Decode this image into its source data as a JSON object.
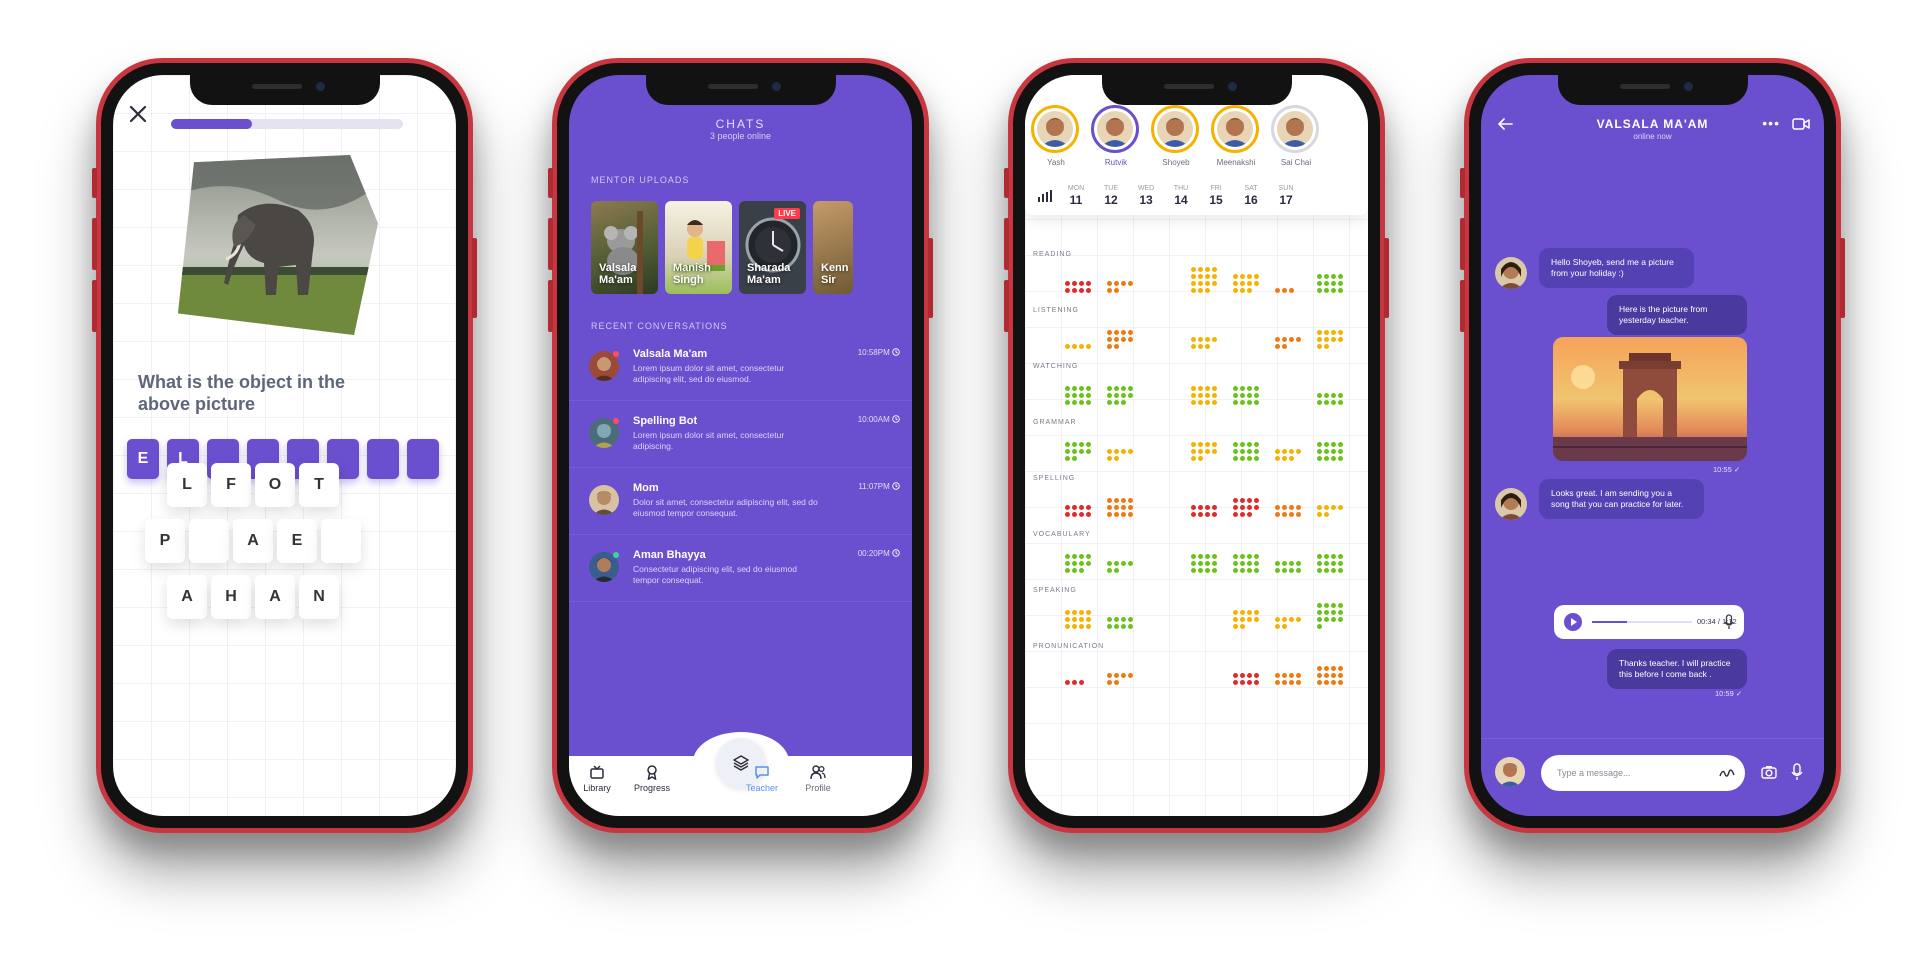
{
  "quiz": {
    "progress": 0.35,
    "question": "What is the object in the above picture",
    "answer_slots": [
      "E",
      "L",
      "",
      "",
      "",
      "",
      "",
      ""
    ],
    "tiles_row1": [
      "L",
      "F",
      "O",
      "T"
    ],
    "tiles_row2": [
      "P",
      "",
      "A",
      "E",
      ""
    ],
    "tiles_row3": [
      "A",
      "H",
      "A",
      "N"
    ]
  },
  "chats": {
    "title": "CHATS",
    "subtitle": "3 people online",
    "mentor_uploads_label": "MENTOR UPLOADS",
    "uploads": [
      {
        "name_line1": "Valsala",
        "name_line2": "Ma'am"
      },
      {
        "name_line1": "Manish",
        "name_line2": "Singh"
      },
      {
        "name_line1": "Sharada",
        "name_line2": "Ma'am",
        "live": "LIVE"
      },
      {
        "name_line1": "Kenn",
        "name_line2": "Sir"
      }
    ],
    "recent_label": "RECENT CONVERSATIONS",
    "conversations": [
      {
        "name": "Valsala Ma'am",
        "time": "10:58PM",
        "message": "Lorem ipsum dolor sit amet, consectetur adipiscing elit, sed do eiusmod."
      },
      {
        "name": "Spelling Bot",
        "time": "10:00AM",
        "message": "Lorem ipsum dolor sit amet, consectetur adipiscing."
      },
      {
        "name": "Mom",
        "time": "11:07PM",
        "message": "Dolor sit amet, consectetur adipiscing elit, sed do eiusmod tempor consequat."
      },
      {
        "name": "Aman Bhayya",
        "time": "00:20PM",
        "message": "Consectetur adipiscing elit, sed do eiusmod tempor consequat."
      }
    ],
    "tabs": [
      "Library",
      "Progress",
      "Teacher",
      "Profile"
    ],
    "accent": "#6a4fcf",
    "active_tab_color": "#5b8def"
  },
  "progress_screen": {
    "students": [
      "Yash",
      "Rutvik",
      "Shoyeb",
      "Meenakshi",
      "Sai Chai"
    ],
    "days": [
      {
        "d": "MON",
        "n": "11"
      },
      {
        "d": "TUE",
        "n": "12"
      },
      {
        "d": "WED",
        "n": "13"
      },
      {
        "d": "THU",
        "n": "14"
      },
      {
        "d": "FRI",
        "n": "15"
      },
      {
        "d": "SAT",
        "n": "16"
      },
      {
        "d": "SUN",
        "n": "17"
      }
    ],
    "skills": [
      "READING",
      "LISTENING",
      "WATCHING",
      "GRAMMAR",
      "SPELLING",
      "VOCABULARY",
      "SPEAKING",
      "PRONUNICATION"
    ],
    "colors": {
      "red": "#e02b2b",
      "orange": "#f07a12",
      "yellow": "#f5b300",
      "green": "#6cc21a",
      "ring_yellow": "#f5b300",
      "ring_purple": "#6a4fcf"
    }
  },
  "chat_detail": {
    "name": "VALSALA MA'AM",
    "status": "online now",
    "messages": [
      {
        "from": "in",
        "text": "Hello Shoyeb, send me a picture from your holiday :)"
      },
      {
        "from": "out",
        "text": "Here is the picture from yesterday teacher."
      },
      {
        "from": "out_time",
        "text": "10:55 ✓"
      },
      {
        "from": "in",
        "text": "Looks great. I am sending you a song that you can practice for later."
      },
      {
        "from": "audio",
        "text": "00:34 / 1:12"
      },
      {
        "from": "out",
        "text": "Thanks teacher. I will practice this before I come back ."
      },
      {
        "from": "out_time",
        "text": "10:59 ✓"
      }
    ],
    "audio_progress": 0.35,
    "input_placeholder": "Type a message..."
  }
}
